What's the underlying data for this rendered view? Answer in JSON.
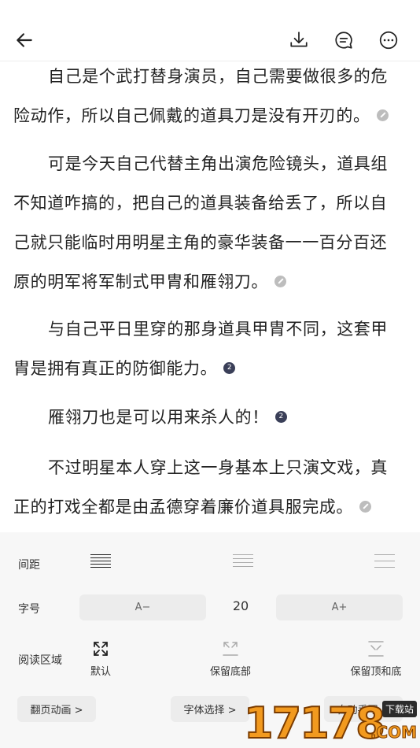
{
  "reader": {
    "paragraphs": [
      {
        "lines": [
          "自己是个武打替身演员，自己需要做很多的危",
          "险动作，所以自己佩戴的道具刀是没有开刃的。"
        ],
        "mark": "pencil",
        "mark_text": ""
      },
      {
        "lines": [
          "可是今天自己代替主角出演危险镜头，道具组",
          "不知道咋搞的，把自己的道具装备给丢了，所以自",
          "己就只能临时用明星主角的豪华装备一一百分百还",
          "原的明军将军制式甲胄和雁翎刀。"
        ],
        "mark": "pencil",
        "mark_text": ""
      },
      {
        "lines": [
          "与自己平日里穿的那身道具甲胄不同，这套甲",
          "胄是拥有真正的防御能力。"
        ],
        "mark": "count",
        "mark_text": "2"
      },
      {
        "lines": [
          "雁翎刀也是可以用来杀人的！"
        ],
        "mark": "count",
        "mark_text": "2"
      },
      {
        "lines": [
          "不过明星本人穿上这一身基本上只演文戏，真",
          "正的打戏全都是由孟德穿着廉价道具服完成。"
        ],
        "mark": "pencil",
        "mark_text": ""
      }
    ]
  },
  "settings": {
    "spacing_label": "间距",
    "font_label": "字号",
    "font_decrease": "A−",
    "font_size": "20",
    "font_increase": "A+",
    "area_label": "阅读区域",
    "area_options": [
      "默认",
      "保留底部",
      "保留顶和底"
    ],
    "page_anim": "翻页动画 >",
    "font_select": "字体选择 >",
    "third_pill": "自动手写 >"
  },
  "watermark": {
    "digits": "17178",
    "badge": "下载站",
    "suffix": ".COM"
  },
  "icons": {
    "back": "arrow-left-icon",
    "download": "download-icon",
    "comment": "comment-icon",
    "more": "more-dots-icon"
  }
}
